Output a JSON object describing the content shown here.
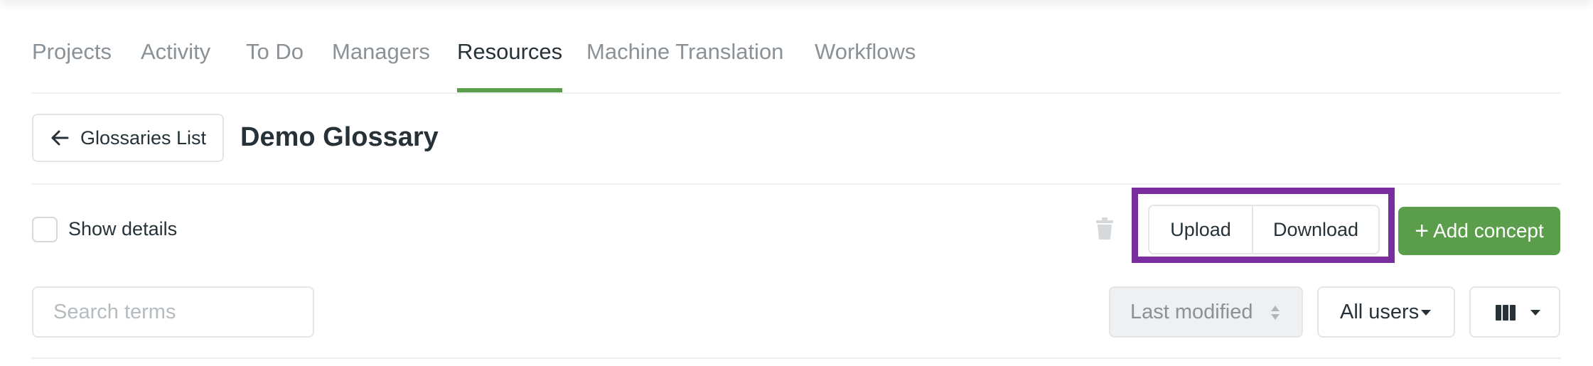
{
  "nav": {
    "tabs": [
      {
        "label": "Projects"
      },
      {
        "label": "Activity"
      },
      {
        "label": "To Do"
      },
      {
        "label": "Managers"
      },
      {
        "label": "Resources",
        "active": true
      },
      {
        "label": "Machine Translation"
      },
      {
        "label": "Workflows"
      }
    ]
  },
  "header": {
    "back_label": "Glossaries List",
    "title": "Demo Glossary"
  },
  "toolbar": {
    "show_details_label": "Show details",
    "show_details_checked": false,
    "upload_label": "Upload",
    "download_label": "Download",
    "add_label": "Add concept",
    "add_icon": "+"
  },
  "filters": {
    "search_placeholder": "Search terms",
    "sort_label": "Last modified",
    "users_label": "All users"
  },
  "colors": {
    "accent": "#5a9e4b",
    "highlight": "#7a2d9e"
  },
  "icons": {
    "back": "arrow-left-icon",
    "trash": "trash-icon",
    "sort": "sort-icon",
    "columns": "columns-icon",
    "caret": "caret-down-icon"
  }
}
